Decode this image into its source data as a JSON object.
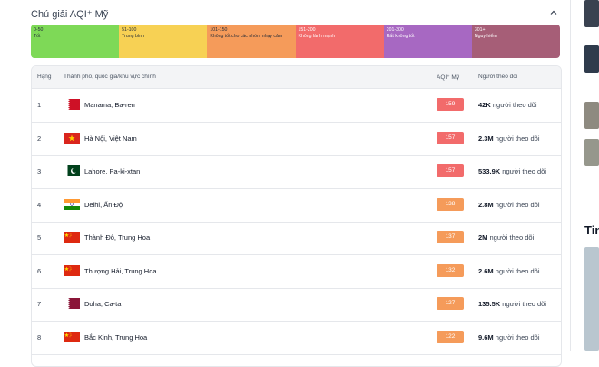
{
  "legend": {
    "title": "Chú giải AQI⁺ Mỹ",
    "segments": [
      {
        "range": "0-50",
        "label": "Tốt",
        "color": "#7ed957"
      },
      {
        "range": "51-100",
        "label": "Trung bình",
        "color": "#f7d154"
      },
      {
        "range": "101-150",
        "label": "Không tốt cho các nhóm nhạy cảm",
        "color": "#f59b5a"
      },
      {
        "range": "151-200",
        "label": "Không lành mạnh",
        "color": "#f26b6b"
      },
      {
        "range": "201-300",
        "label": "Rất không tốt",
        "color": "#a768c2"
      },
      {
        "range": "301+",
        "label": "Nguy hiểm",
        "color": "#a65e77"
      }
    ]
  },
  "table": {
    "headers": {
      "rank": "Hạng",
      "city": "Thành phố, quốc gia/khu vực chính",
      "aqi": "AQI⁺ Mỹ",
      "followers": "Người theo dõi"
    },
    "followers_suffix": "người theo dõi",
    "rows": [
      {
        "rank": "1",
        "city": "Manama, Ba-ren",
        "flag": "bahrain-flag-icon",
        "aqi": "159",
        "level": "red",
        "followers": "42K"
      },
      {
        "rank": "2",
        "city": "Hà Nội, Việt Nam",
        "flag": "vietnam-flag-icon",
        "aqi": "157",
        "level": "red",
        "followers": "2.3M"
      },
      {
        "rank": "3",
        "city": "Lahore, Pa-ki-xtan",
        "flag": "pakistan-flag-icon",
        "aqi": "157",
        "level": "red",
        "followers": "533.9K"
      },
      {
        "rank": "4",
        "city": "Delhi, Ấn Độ",
        "flag": "india-flag-icon",
        "aqi": "138",
        "level": "orange",
        "followers": "2.8M"
      },
      {
        "rank": "5",
        "city": "Thành Đô, Trung Hoa",
        "flag": "china-flag-icon",
        "aqi": "137",
        "level": "orange",
        "followers": "2M"
      },
      {
        "rank": "6",
        "city": "Thượng Hải, Trung Hoa",
        "flag": "china-flag-icon",
        "aqi": "132",
        "level": "orange",
        "followers": "2.6M"
      },
      {
        "rank": "7",
        "city": "Doha, Ca-ta",
        "flag": "qatar-flag-icon",
        "aqi": "127",
        "level": "orange",
        "followers": "135.5K"
      },
      {
        "rank": "8",
        "city": "Bắc Kinh, Trung Hoa",
        "flag": "china-flag-icon",
        "aqi": "122",
        "level": "orange",
        "followers": "9.6M"
      }
    ]
  },
  "sidebar": {
    "title_partial": "Tin"
  }
}
